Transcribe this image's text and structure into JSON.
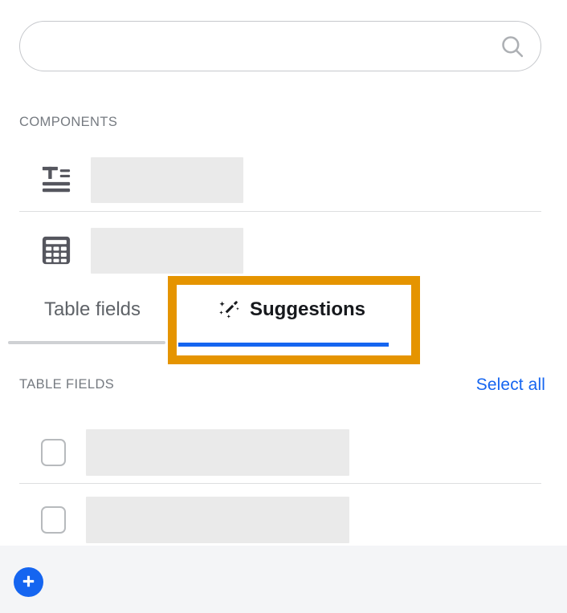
{
  "search": {
    "value": "",
    "placeholder": "",
    "icon": "search-icon"
  },
  "components_section": {
    "header": "COMPONENTS",
    "items": [
      {
        "icon": "text-block-icon",
        "label": ""
      },
      {
        "icon": "table-grid-icon",
        "label": ""
      }
    ]
  },
  "tabs": {
    "items": [
      {
        "label": "Table fields",
        "active": false,
        "icon": ""
      },
      {
        "label": "Suggestions",
        "active": true,
        "icon": "magic-wand-icon"
      }
    ],
    "active_index": 1,
    "active_underline_color": "#1565f0",
    "highlight_color": "#e59400"
  },
  "table_fields_section": {
    "header": "TABLE FIELDS",
    "select_all_label": "Select all",
    "select_all_color": "#1565f0",
    "rows": [
      {
        "checked": false,
        "label": ""
      },
      {
        "checked": false,
        "label": ""
      }
    ]
  },
  "footer": {
    "add_button": {
      "icon": "plus-icon",
      "label": "",
      "color": "#1565f0"
    },
    "background": "#f4f5f7"
  }
}
